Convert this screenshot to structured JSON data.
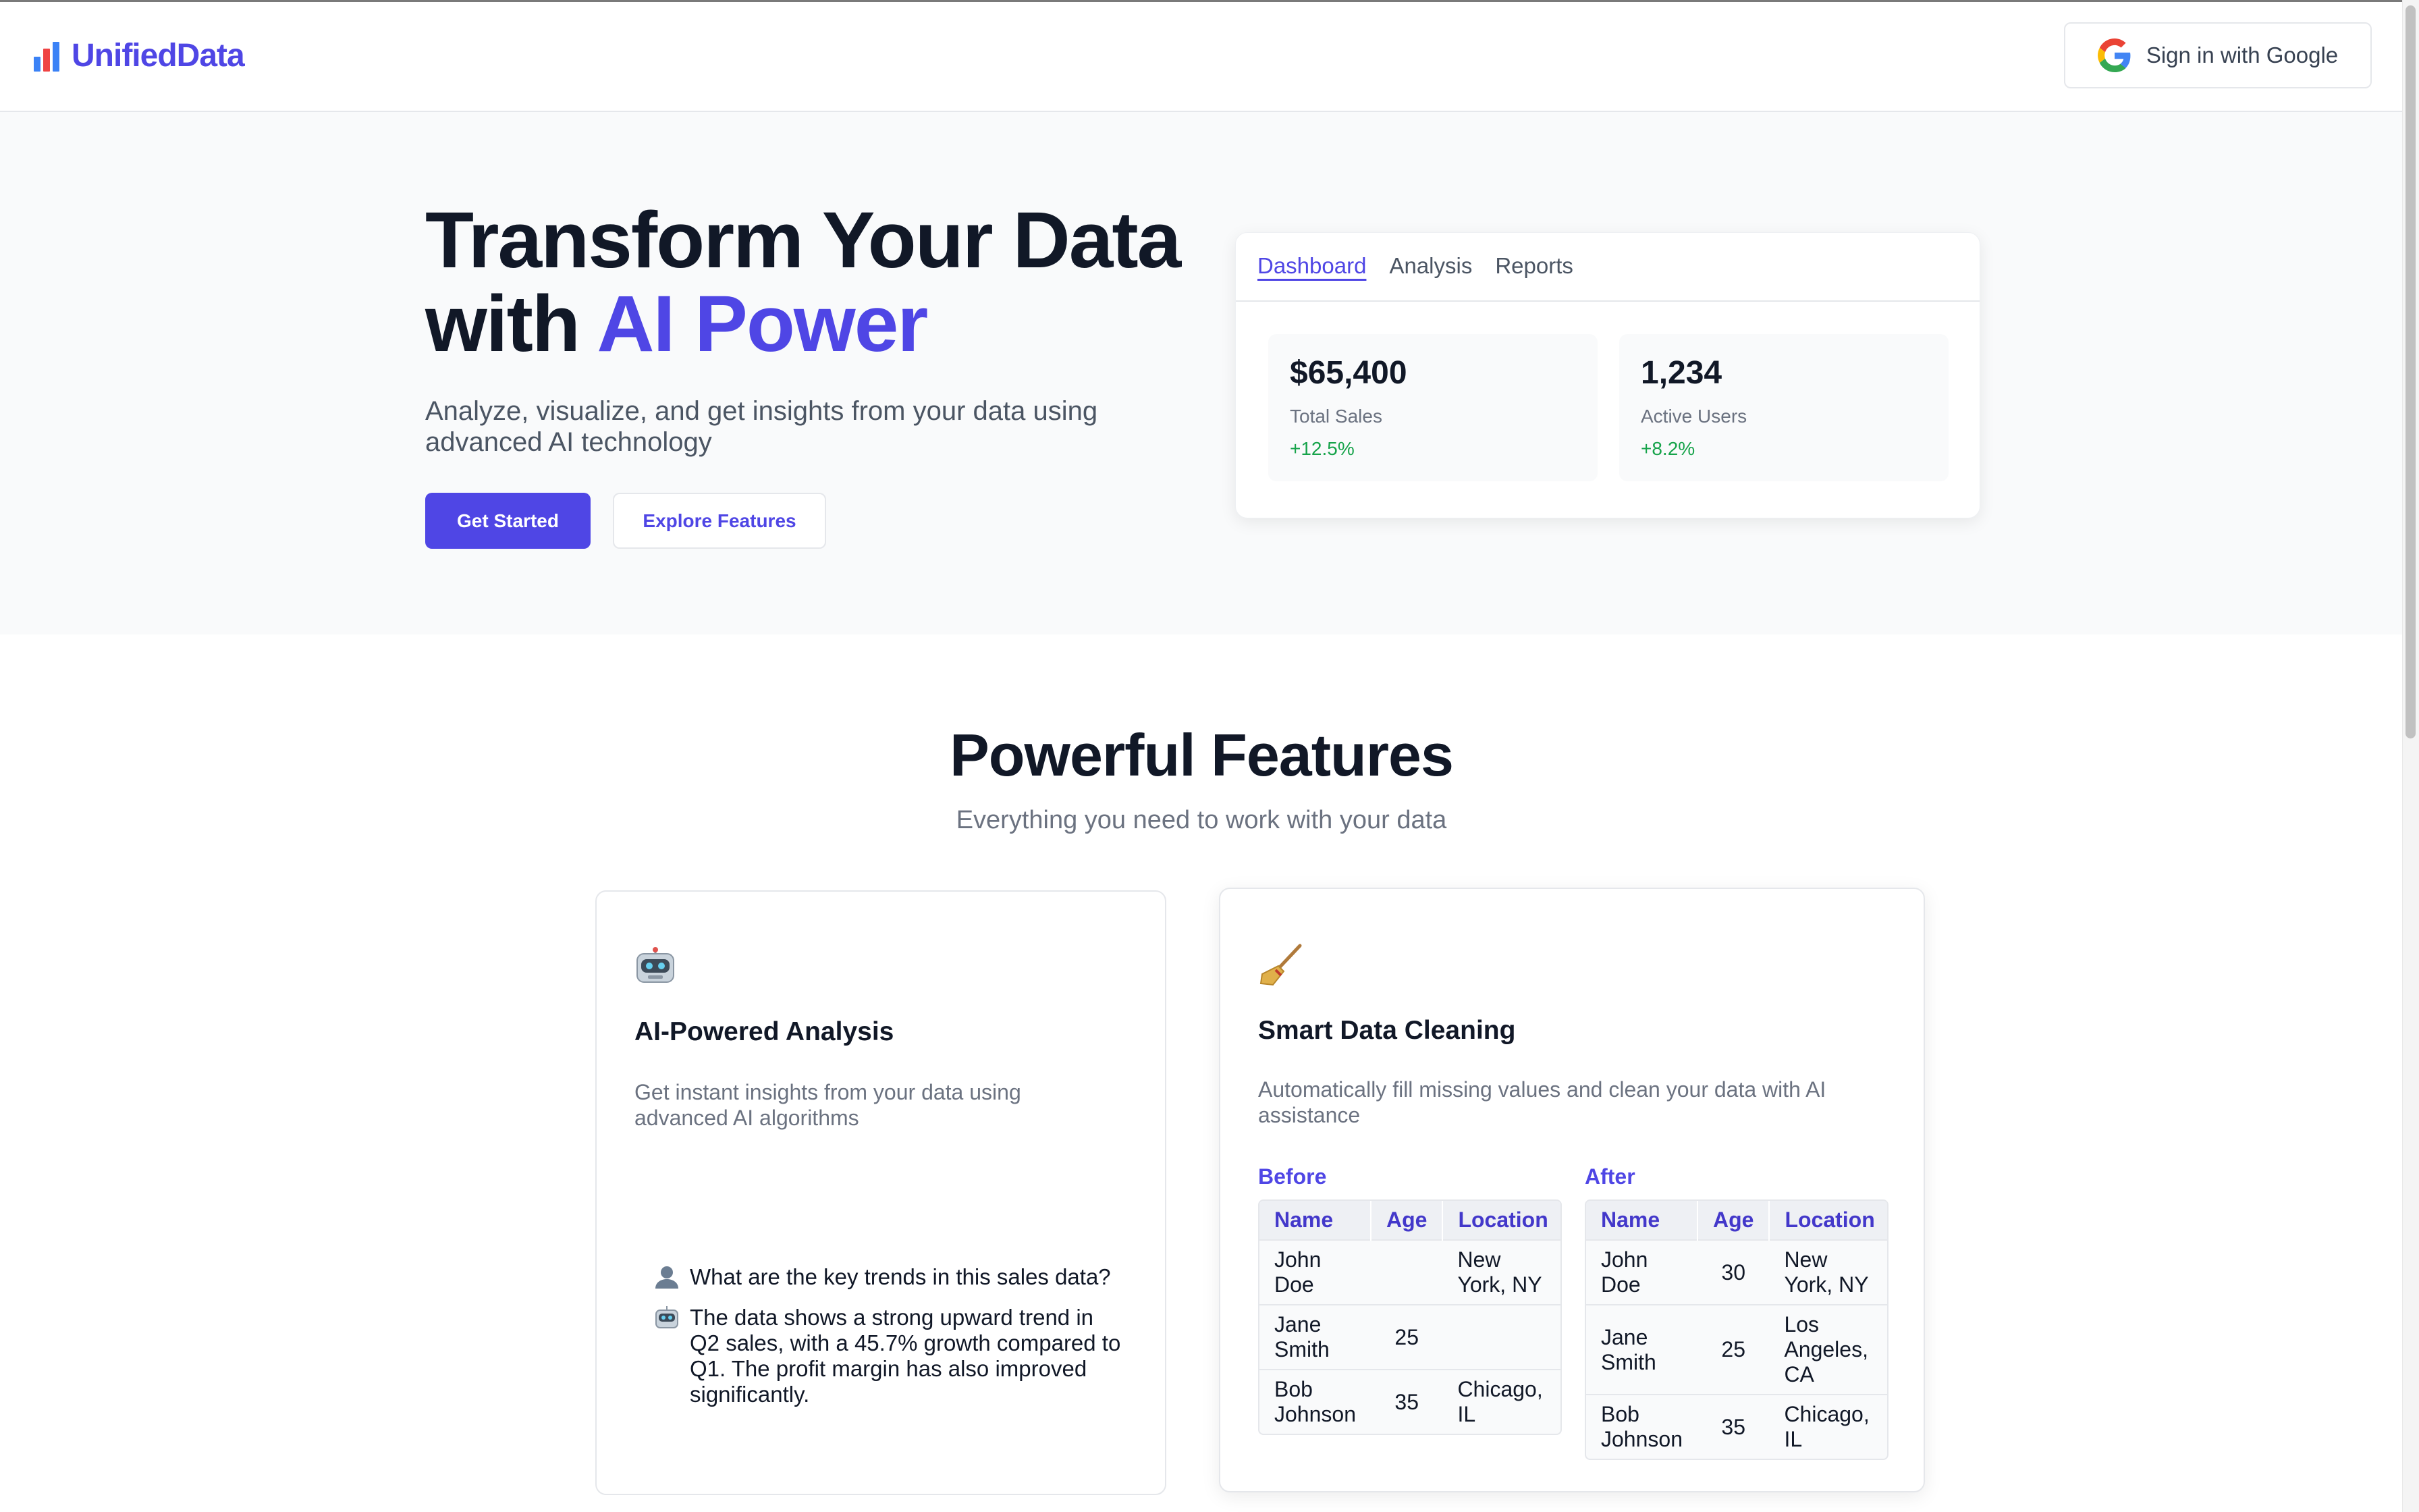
{
  "brand": {
    "name": "UnifiedData"
  },
  "nav": {
    "signin_label": "Sign in with Google"
  },
  "hero": {
    "title_line1": "Transform Your Data",
    "title_line2_prefix": "with ",
    "title_line2_accent": "AI Power",
    "subtitle": "Analyze, visualize, and get insights from your data using advanced AI technology",
    "primary_cta": "Get Started",
    "secondary_cta": "Explore Features"
  },
  "dashboard": {
    "tabs": [
      "Dashboard",
      "Analysis",
      "Reports"
    ],
    "stats": [
      {
        "value": "$65,400",
        "label": "Total Sales",
        "change": "+12.5%"
      },
      {
        "value": "1,234",
        "label": "Active Users",
        "change": "+8.2%"
      }
    ]
  },
  "features": {
    "title": "Powerful Features",
    "subtitle": "Everything you need to work with your data",
    "cards": [
      {
        "icon": "robot-icon",
        "title": "AI-Powered Analysis",
        "description": "Get instant insights from your data using advanced AI algorithms",
        "chat": [
          {
            "role": "user",
            "text": "What are the key trends in this sales data?"
          },
          {
            "role": "ai",
            "text": "The data shows a strong upward trend in Q2 sales, with a 45.7% growth compared to Q1. The profit margin has also improved significantly."
          }
        ]
      },
      {
        "icon": "broom-icon",
        "title": "Smart Data Cleaning",
        "description": "Automatically fill missing values and clean your data with AI assistance",
        "before_label": "Before",
        "after_label": "After",
        "columns": [
          "Name",
          "Age",
          "Location"
        ],
        "before_rows": [
          [
            "John Doe",
            "",
            "New York, NY"
          ],
          [
            "Jane Smith",
            "25",
            ""
          ],
          [
            "Bob Johnson",
            "35",
            "Chicago, IL"
          ]
        ],
        "after_rows": [
          [
            "John Doe",
            "30",
            "New York, NY"
          ],
          [
            "Jane Smith",
            "25",
            "Los Angeles, CA"
          ],
          [
            "Bob Johnson",
            "35",
            "Chicago, IL"
          ]
        ]
      }
    ]
  },
  "colors": {
    "accent": "#4f46e5",
    "positive": "#16a34a",
    "text": "#111827",
    "muted": "#6b7280"
  }
}
